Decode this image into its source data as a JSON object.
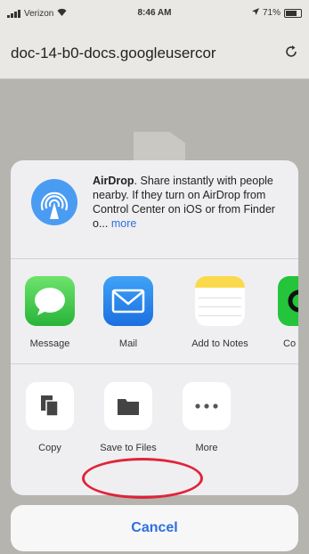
{
  "status_bar": {
    "carrier": "Verizon",
    "time": "8:46 AM",
    "battery": "71%"
  },
  "browser": {
    "url": "doc-14-b0-docs.googleusercor",
    "reload_icon": "reload-icon"
  },
  "share_sheet": {
    "airdrop": {
      "title": "AirDrop",
      "text": ". Share instantly with people nearby. If they turn on AirDrop from Control Center on iOS or from Finder o...",
      "more": "more"
    },
    "apps": [
      {
        "label": "Message",
        "icon": "message-icon"
      },
      {
        "label": "Mail",
        "icon": "mail-icon"
      },
      {
        "label": "Add to Notes",
        "icon": "notes-icon"
      },
      {
        "label": "Co mic",
        "icon": "app-icon"
      }
    ],
    "actions": [
      {
        "label": "Copy",
        "icon": "copy-icon"
      },
      {
        "label": "Save to Files",
        "icon": "folder-icon"
      },
      {
        "label": "More",
        "icon": "more-icon"
      }
    ]
  },
  "cancel_label": "Cancel",
  "annotation": {
    "highlight_color": "#e0243a"
  }
}
